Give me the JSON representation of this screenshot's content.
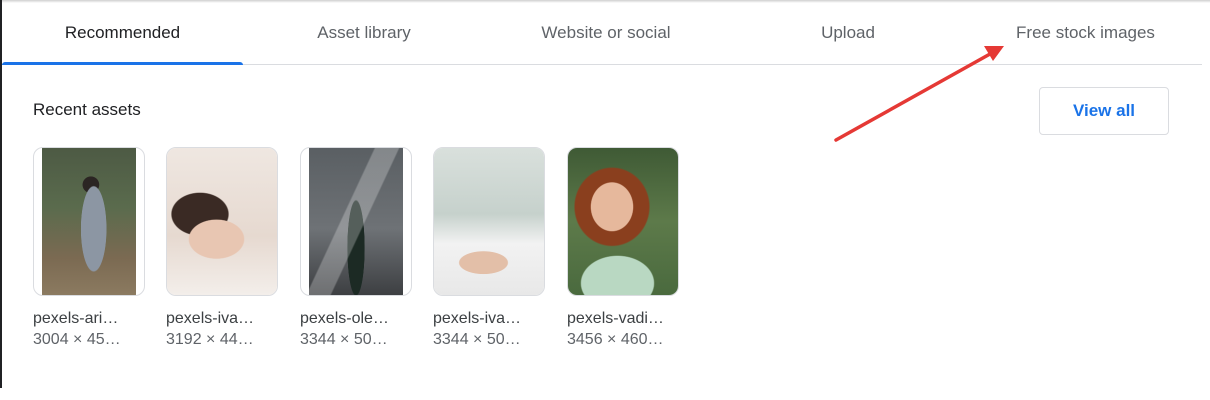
{
  "tabs": [
    {
      "label": "Recommended",
      "active": true
    },
    {
      "label": "Asset library",
      "active": false
    },
    {
      "label": "Website or social",
      "active": false
    },
    {
      "label": "Upload",
      "active": false
    },
    {
      "label": "Free stock images",
      "active": false
    }
  ],
  "recent": {
    "title": "Recent assets",
    "view_all_label": "View all"
  },
  "assets": [
    {
      "name": "pexels-ari…",
      "dims": "3004 × 45…"
    },
    {
      "name": "pexels-iva…",
      "dims": "3192 × 44…"
    },
    {
      "name": "pexels-ole…",
      "dims": "3344 × 50…"
    },
    {
      "name": "pexels-iva…",
      "dims": "3344 × 50…"
    },
    {
      "name": "pexels-vadi…",
      "dims": "3456 × 460…"
    }
  ],
  "colors": {
    "accent": "#1a73e8",
    "annotation_arrow": "#e53935"
  }
}
